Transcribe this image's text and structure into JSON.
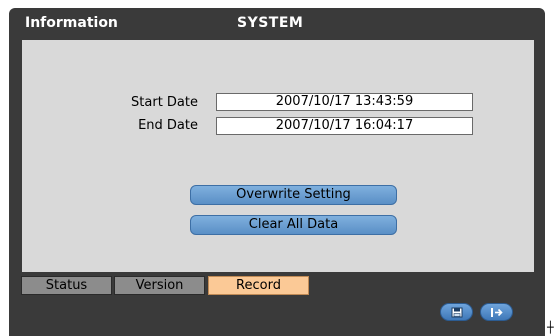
{
  "window": {
    "title_left": "Information",
    "title_center": "SYSTEM"
  },
  "record": {
    "start_date_label": "Start Date",
    "start_date_value": "2007/10/17  13:43:59",
    "end_date_label": "End Date",
    "end_date_value": "2007/10/17  16:04:17"
  },
  "actions": {
    "overwrite_label": "Overwrite Setting",
    "clear_label": "Clear All Data"
  },
  "tabs": [
    {
      "label": "Status",
      "active": false
    },
    {
      "label": "Version",
      "active": false
    },
    {
      "label": "Record",
      "active": true
    }
  ],
  "toolbar": {
    "save_icon": "save-icon",
    "exit_icon": "exit-icon"
  },
  "colors": {
    "window_bg": "#3a3a3a",
    "panel_bg": "#d9d9d9",
    "button_blue": "#6a9fd2",
    "tab_inactive": "#8c8c8c",
    "tab_active": "#fbc996"
  }
}
